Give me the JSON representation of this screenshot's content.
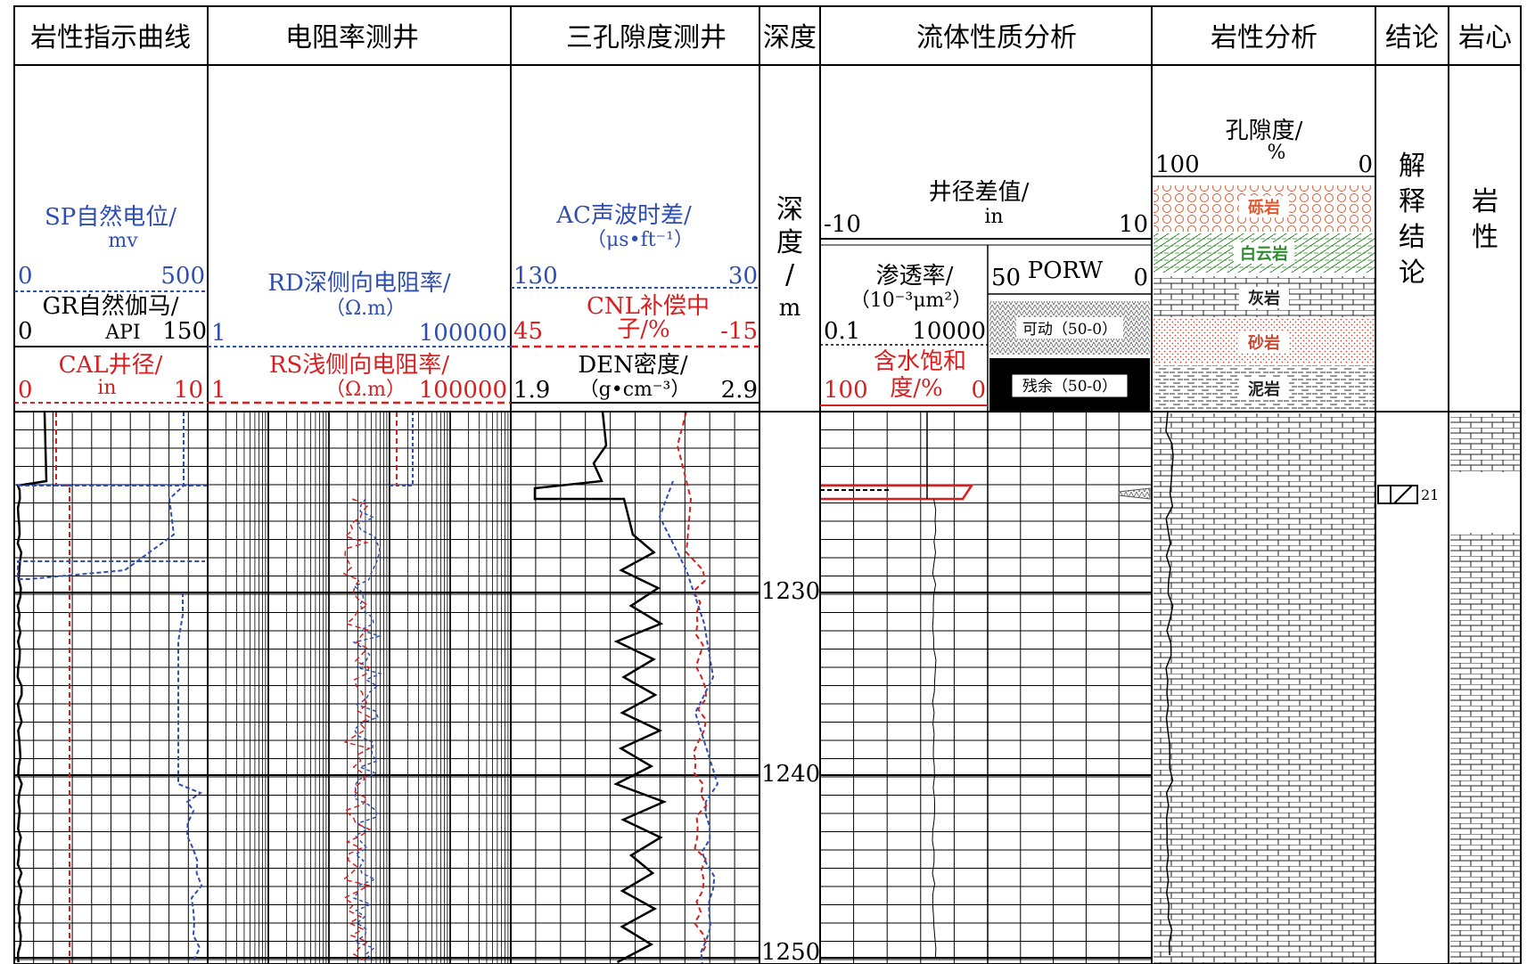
{
  "colors": {
    "black": "#000000",
    "blue": "#2f4fb0",
    "red": "#d81e1e",
    "green": "#2e8b2e",
    "orange": "#e4572e",
    "tan": "#c9472e",
    "pattern": "#444444"
  },
  "headers": {
    "lith_indicator": "岩性指示曲线",
    "resistivity": "电阻率测井",
    "porosity": "三孔隙度测井",
    "depth": "深度",
    "fluid": "流体性质分析",
    "lithology": "岩性分析",
    "conclusion": "结论",
    "core": "岩心"
  },
  "track1": {
    "sp_label": "SP自然电位/",
    "sp_unit": "mv",
    "sp_min": "0",
    "sp_max": "500",
    "gr_label": "GR自然伽马/",
    "gr_unit": "API",
    "gr_min": "0",
    "gr_max": "150",
    "cal_label": "CAL井径/",
    "cal_unit": "in",
    "cal_min": "0",
    "cal_max": "10"
  },
  "track2": {
    "rd_label": "RD深侧向电阻率/",
    "rd_unit": "（Ω.m）",
    "rd_min": "1",
    "rd_max": "100000",
    "rs_label": "RS浅侧向电阻率/",
    "rs_unit": "（Ω.m）",
    "rs_min": "1",
    "rs_max": "100000"
  },
  "track3": {
    "ac_label": "AC声波时差/",
    "ac_unit": "（μs•ft⁻¹）",
    "ac_min": "130",
    "ac_max": "30",
    "cnl_label": "CNL补偿中",
    "cnl_label2": "子/%",
    "cnl_min": "45",
    "cnl_max": "-15",
    "den_label": "DEN密度/",
    "den_unit": "（g•cm⁻³）",
    "den_min": "1.9",
    "den_max": "2.9"
  },
  "depth_track": {
    "title_chars": [
      "深",
      "度",
      "/",
      "m"
    ],
    "ticks": [
      "1230",
      "1240",
      "1250"
    ]
  },
  "fluid_track": {
    "caliper_diff_label": "井径差值/",
    "caliper_diff_unit": "in",
    "caliper_diff_min": "-10",
    "caliper_diff_max": "10",
    "perm_label": "渗透率/",
    "perm_unit": "（10⁻³μm²）",
    "perm_min": "0.1",
    "perm_max": "10000",
    "sw_label": "含水饱和",
    "sw_label2": "度/%",
    "sw_min": "100",
    "sw_max": "0",
    "porw_label": "PORW",
    "porw_min": "50",
    "porw_max": "0",
    "movable_label": "可动（50-0）",
    "residual_label": "残余（50-0）"
  },
  "lith_track": {
    "por_label": "孔隙度/",
    "por_unit": "%",
    "por_min": "100",
    "por_max": "0",
    "legend": [
      "砾岩",
      "白云岩",
      "灰岩",
      "砂岩",
      "泥岩"
    ]
  },
  "conclusion_track": {
    "title_chars": [
      "解",
      "释",
      "结",
      "论"
    ],
    "layer_no": "21"
  },
  "core_track": {
    "title_chars": [
      "岩",
      "性"
    ]
  }
}
